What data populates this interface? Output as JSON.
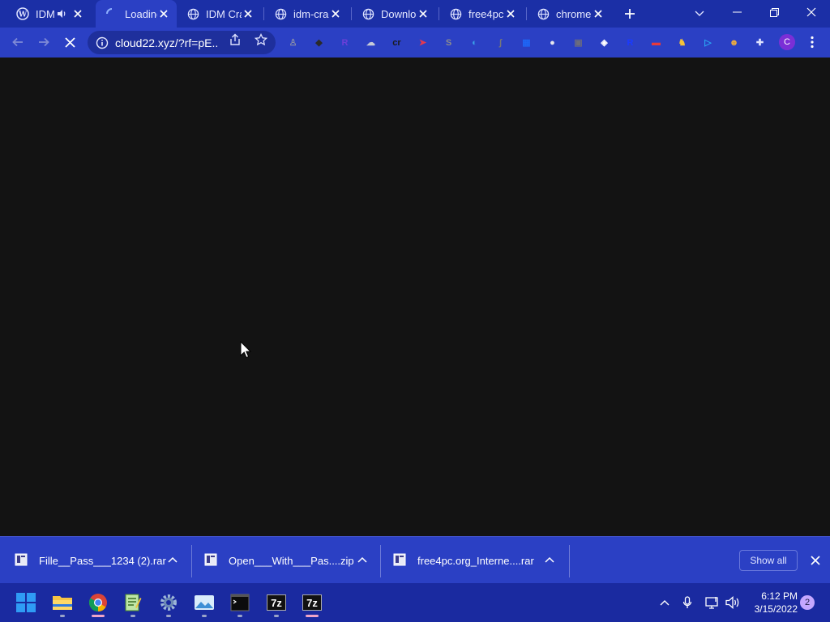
{
  "browser": {
    "tabs": [
      {
        "title": "IDM",
        "favicon": "wordpress-icon",
        "audio": true
      },
      {
        "title": "Loading",
        "favicon": "loading-spinner-icon",
        "active": true
      },
      {
        "title": "IDM Crack",
        "favicon": "globe-icon"
      },
      {
        "title": "idm-crack",
        "favicon": "globe-icon"
      },
      {
        "title": "Download",
        "favicon": "globe-icon"
      },
      {
        "title": "free4pc",
        "favicon": "globe-icon"
      },
      {
        "title": "chrome",
        "favicon": "globe-icon"
      }
    ],
    "new_tab_icon": "plus-icon",
    "tab_search_icon": "chevron-down-icon",
    "window_controls": [
      "minimize-icon",
      "restore-icon",
      "close-icon"
    ]
  },
  "toolbar": {
    "url": "cloud22.xyz/?rf=pE...",
    "profile_initial": "C",
    "extensions": [
      {
        "name": "ext-grey",
        "glyph": "♙",
        "color": "#8a8fa8"
      },
      {
        "name": "ext-dark",
        "glyph": "◆",
        "color": "#2a2a2a"
      },
      {
        "name": "ext-r-purple",
        "glyph": "R",
        "color": "#6b3fd8"
      },
      {
        "name": "ext-cloud",
        "glyph": "☁",
        "color": "#c7ccd8"
      },
      {
        "name": "ext-cr",
        "glyph": "cr",
        "color": "#1b1b1b"
      },
      {
        "name": "ext-red-pointer",
        "glyph": "➤",
        "color": "#e53950"
      },
      {
        "name": "ext-s",
        "glyph": "S",
        "color": "#8d8d8d"
      },
      {
        "name": "ext-edge",
        "glyph": "◐",
        "color": "#3aa0e8"
      },
      {
        "name": "ext-elephant",
        "glyph": "ʃ",
        "color": "#777777"
      },
      {
        "name": "ext-grid",
        "glyph": "▦",
        "color": "#1e66f5"
      },
      {
        "name": "ext-circle",
        "glyph": "●",
        "color": "#e8e8ee"
      },
      {
        "name": "ext-image",
        "glyph": "▣",
        "color": "#6c6c7c"
      },
      {
        "name": "ext-diamond",
        "glyph": "◈",
        "color": "#ffffff"
      },
      {
        "name": "ext-r-blue",
        "glyph": "R",
        "color": "#1b3aff"
      },
      {
        "name": "ext-card",
        "glyph": "▬",
        "color": "#e83a3a"
      },
      {
        "name": "ext-cat",
        "glyph": "♞",
        "color": "#f4c23a"
      },
      {
        "name": "ext-play",
        "glyph": "▷",
        "color": "#2aa7f4"
      },
      {
        "name": "ext-face",
        "glyph": "☻",
        "color": "#f4b03a"
      },
      {
        "name": "ext-puzzle",
        "glyph": "✚",
        "color": "#dfe3ff"
      }
    ]
  },
  "downloads": {
    "items": [
      {
        "filename": "Fille__Pass___1234 (2).rar"
      },
      {
        "filename": "Open___With___Pas....zip"
      },
      {
        "filename": "free4pc.org_Interne....rar"
      }
    ],
    "show_all_label": "Show all"
  },
  "taskbar": {
    "apps": [
      {
        "name": "start-button",
        "icon": "windows-logo-icon"
      },
      {
        "name": "file-explorer",
        "icon": "folder-icon",
        "running": true
      },
      {
        "name": "chrome",
        "icon": "chrome-icon",
        "running": true,
        "active": true
      },
      {
        "name": "notepad-plus",
        "icon": "notepad-icon",
        "running": true
      },
      {
        "name": "settings",
        "icon": "gear-icon",
        "running": true
      },
      {
        "name": "photos",
        "icon": "photos-icon",
        "running": true
      },
      {
        "name": "terminal",
        "icon": "terminal-icon",
        "running": true
      },
      {
        "name": "7zip-1",
        "icon": "7zip-icon",
        "label": "7z",
        "running": true
      },
      {
        "name": "7zip-2",
        "icon": "7zip-icon",
        "label": "7z",
        "running": true,
        "active": true
      }
    ],
    "tray": [
      "chevron-up-icon",
      "microphone-icon",
      "network-icon",
      "volume-icon"
    ],
    "time": "6:12 PM",
    "date": "3/15/2022",
    "notification_count": "2"
  }
}
